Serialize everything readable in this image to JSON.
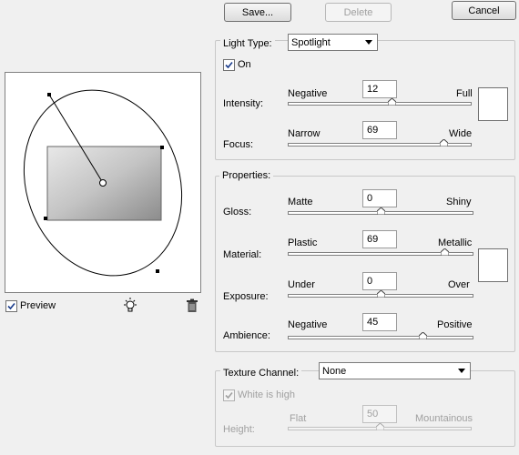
{
  "top_buttons": {
    "save": "Save...",
    "delete": "Delete",
    "cancel": "Cancel"
  },
  "light": {
    "type_label": "Light Type:",
    "type_value": "Spotlight",
    "on_label": "On",
    "on_checked": true,
    "intensity": {
      "label": "Intensity:",
      "min_label": "Negative",
      "max_label": "Full",
      "value": "12"
    },
    "focus": {
      "label": "Focus:",
      "min_label": "Narrow",
      "max_label": "Wide",
      "value": "69"
    },
    "color": "#ffffff"
  },
  "properties": {
    "title": "Properties:",
    "gloss": {
      "label": "Gloss:",
      "min_label": "Matte",
      "max_label": "Shiny",
      "value": "0"
    },
    "material": {
      "label": "Material:",
      "min_label": "Plastic",
      "max_label": "Metallic",
      "value": "69"
    },
    "exposure": {
      "label": "Exposure:",
      "min_label": "Under",
      "max_label": "Over",
      "value": "0"
    },
    "ambience": {
      "label": "Ambience:",
      "min_label": "Negative",
      "max_label": "Positive",
      "value": "45"
    },
    "color": "#ffffff"
  },
  "texture": {
    "channel_label": "Texture Channel:",
    "channel_value": "None",
    "white_is_high_label": "White is high",
    "white_is_high_checked": true,
    "height": {
      "label": "Height:",
      "min_label": "Flat",
      "max_label": "Mountainous",
      "value": "50"
    }
  },
  "preview": {
    "label": "Preview",
    "checked": true,
    "light_icon": "light-bulb-icon",
    "trash_icon": "trash-icon"
  }
}
